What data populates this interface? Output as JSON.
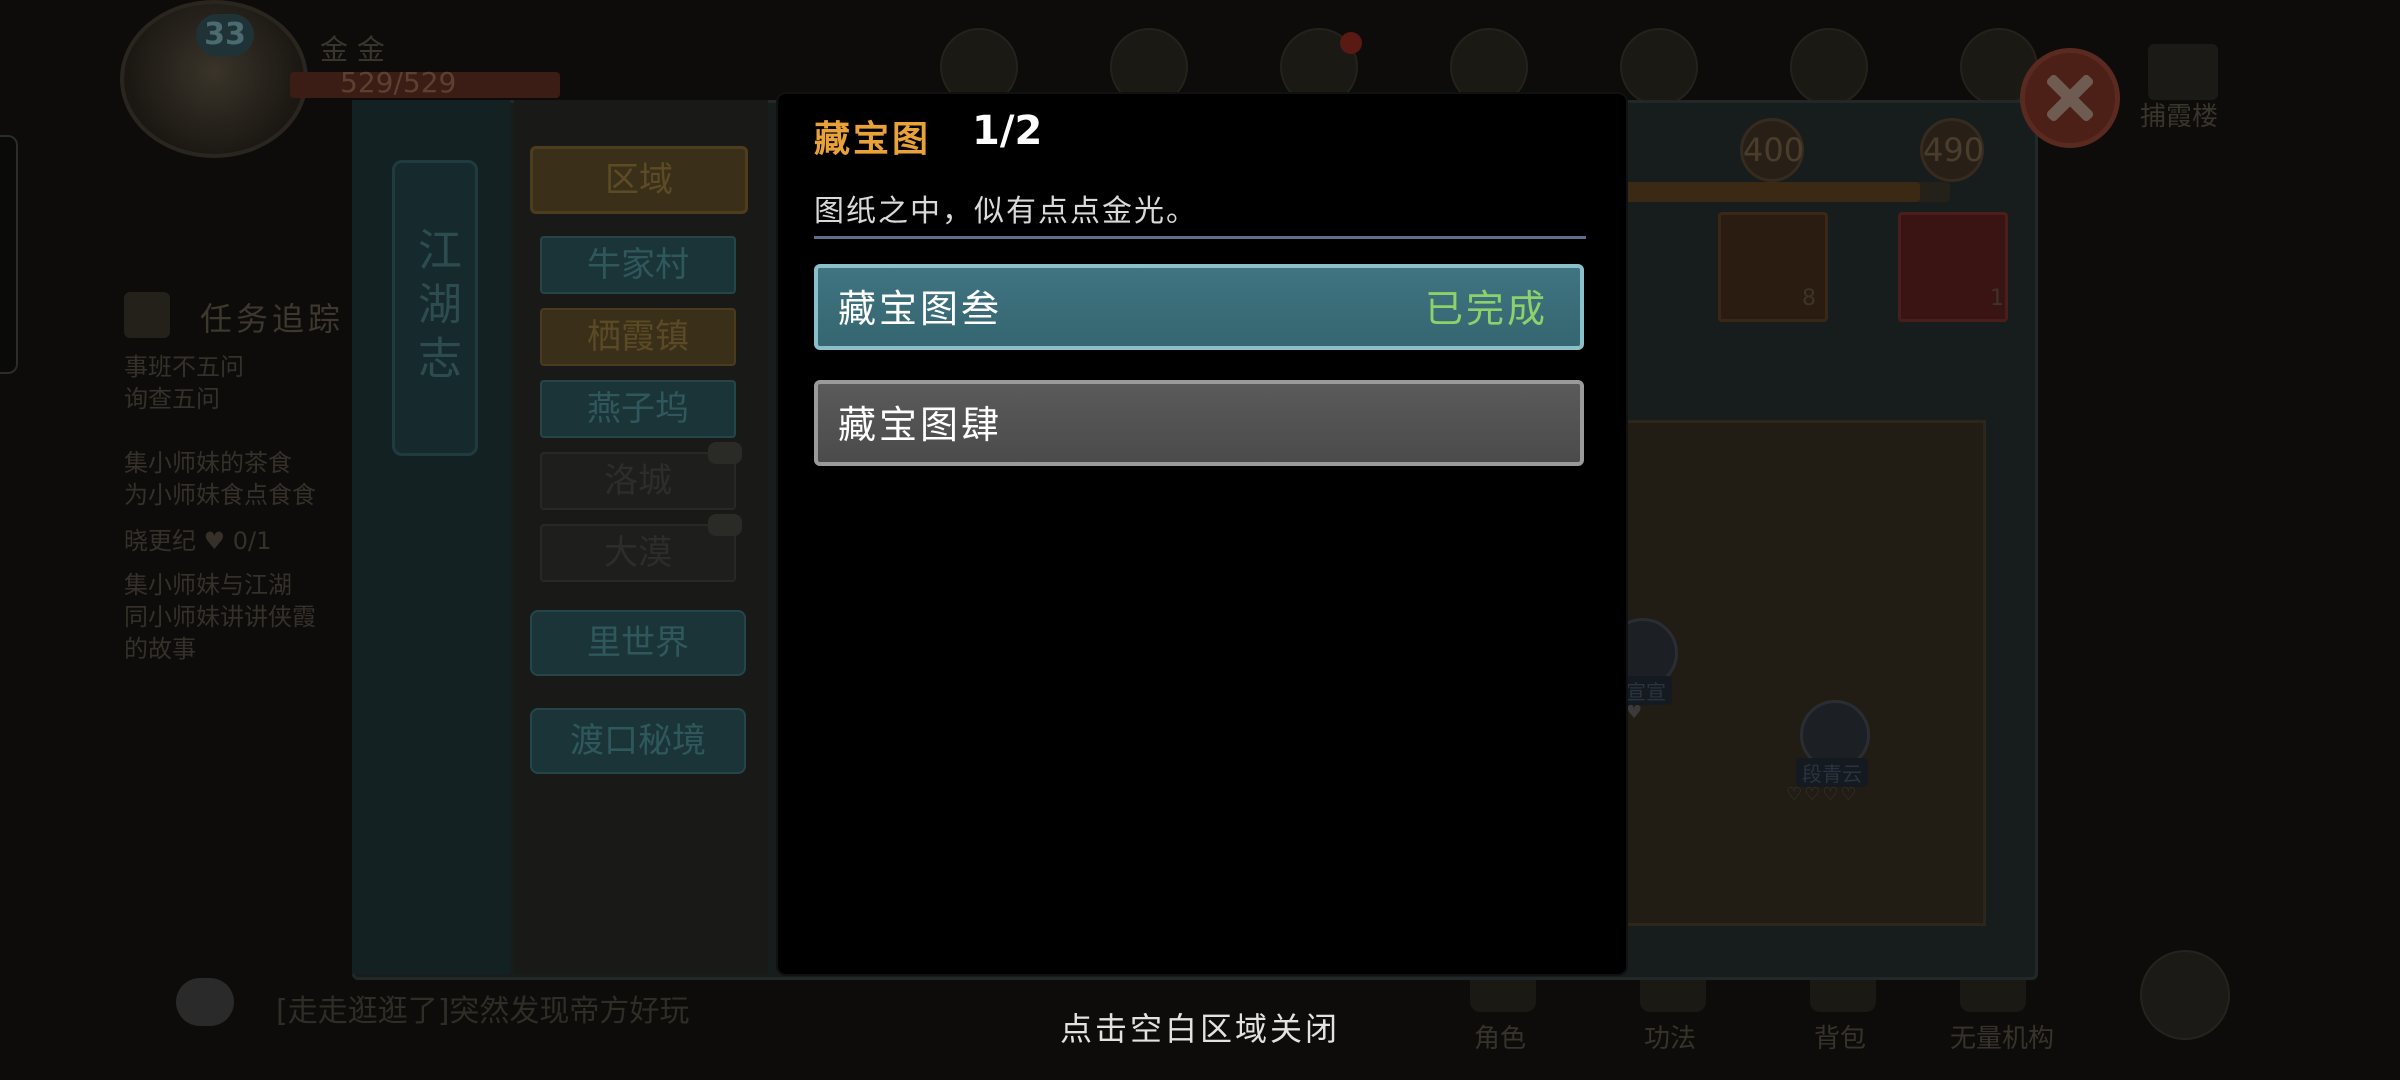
{
  "hud": {
    "level": "33",
    "currency_label": "金 金",
    "hp_text": "529/529",
    "chat_text": "[走走逛逛了]突然发现帝方好玩",
    "bottom_nav": [
      "角色",
      "功法",
      "背包",
      "无量机构"
    ],
    "top_right_label": "捕霞楼"
  },
  "quest_track": {
    "title": "任务追踪",
    "lines": [
      "事班不五问",
      "询查五问",
      "集小师妹的茶食",
      "为小师妹食点食食",
      "晓更纪 ♥ 0/1",
      "集小师妹与江湖",
      "同小师妹讲讲侠霞",
      "的故事"
    ]
  },
  "journal": {
    "spine_title": "江湖志",
    "region_header": "区域",
    "regions": [
      {
        "label": "牛家村",
        "state": "teal"
      },
      {
        "label": "栖霞镇",
        "state": "gold"
      },
      {
        "label": "燕子坞",
        "state": "teal"
      },
      {
        "label": "洛城",
        "state": "locked"
      },
      {
        "label": "大漠",
        "state": "locked"
      }
    ],
    "special_regions": [
      "里世界",
      "渡口秘境"
    ],
    "milestones": [
      "400",
      "490"
    ],
    "reward_counts": [
      "8",
      "1"
    ],
    "npcs": [
      {
        "name": "宣宣",
        "hearts": "♥"
      },
      {
        "name": "段青云",
        "hearts": "♡♡♡♡"
      }
    ]
  },
  "popup": {
    "title": "藏宝图",
    "count": "1/2",
    "description": "图纸之中，似有点点金光。",
    "entries": [
      {
        "name": "藏宝图叁",
        "status": "已完成"
      },
      {
        "name": "藏宝图肆",
        "status": ""
      }
    ]
  },
  "close_hint": "点击空白区域关闭",
  "colors": {
    "title_gold": "#e9a23a",
    "completed_green": "#8cd16a",
    "entry_done_bg": "#3f7481",
    "entry_pending_bg": "#555555"
  }
}
